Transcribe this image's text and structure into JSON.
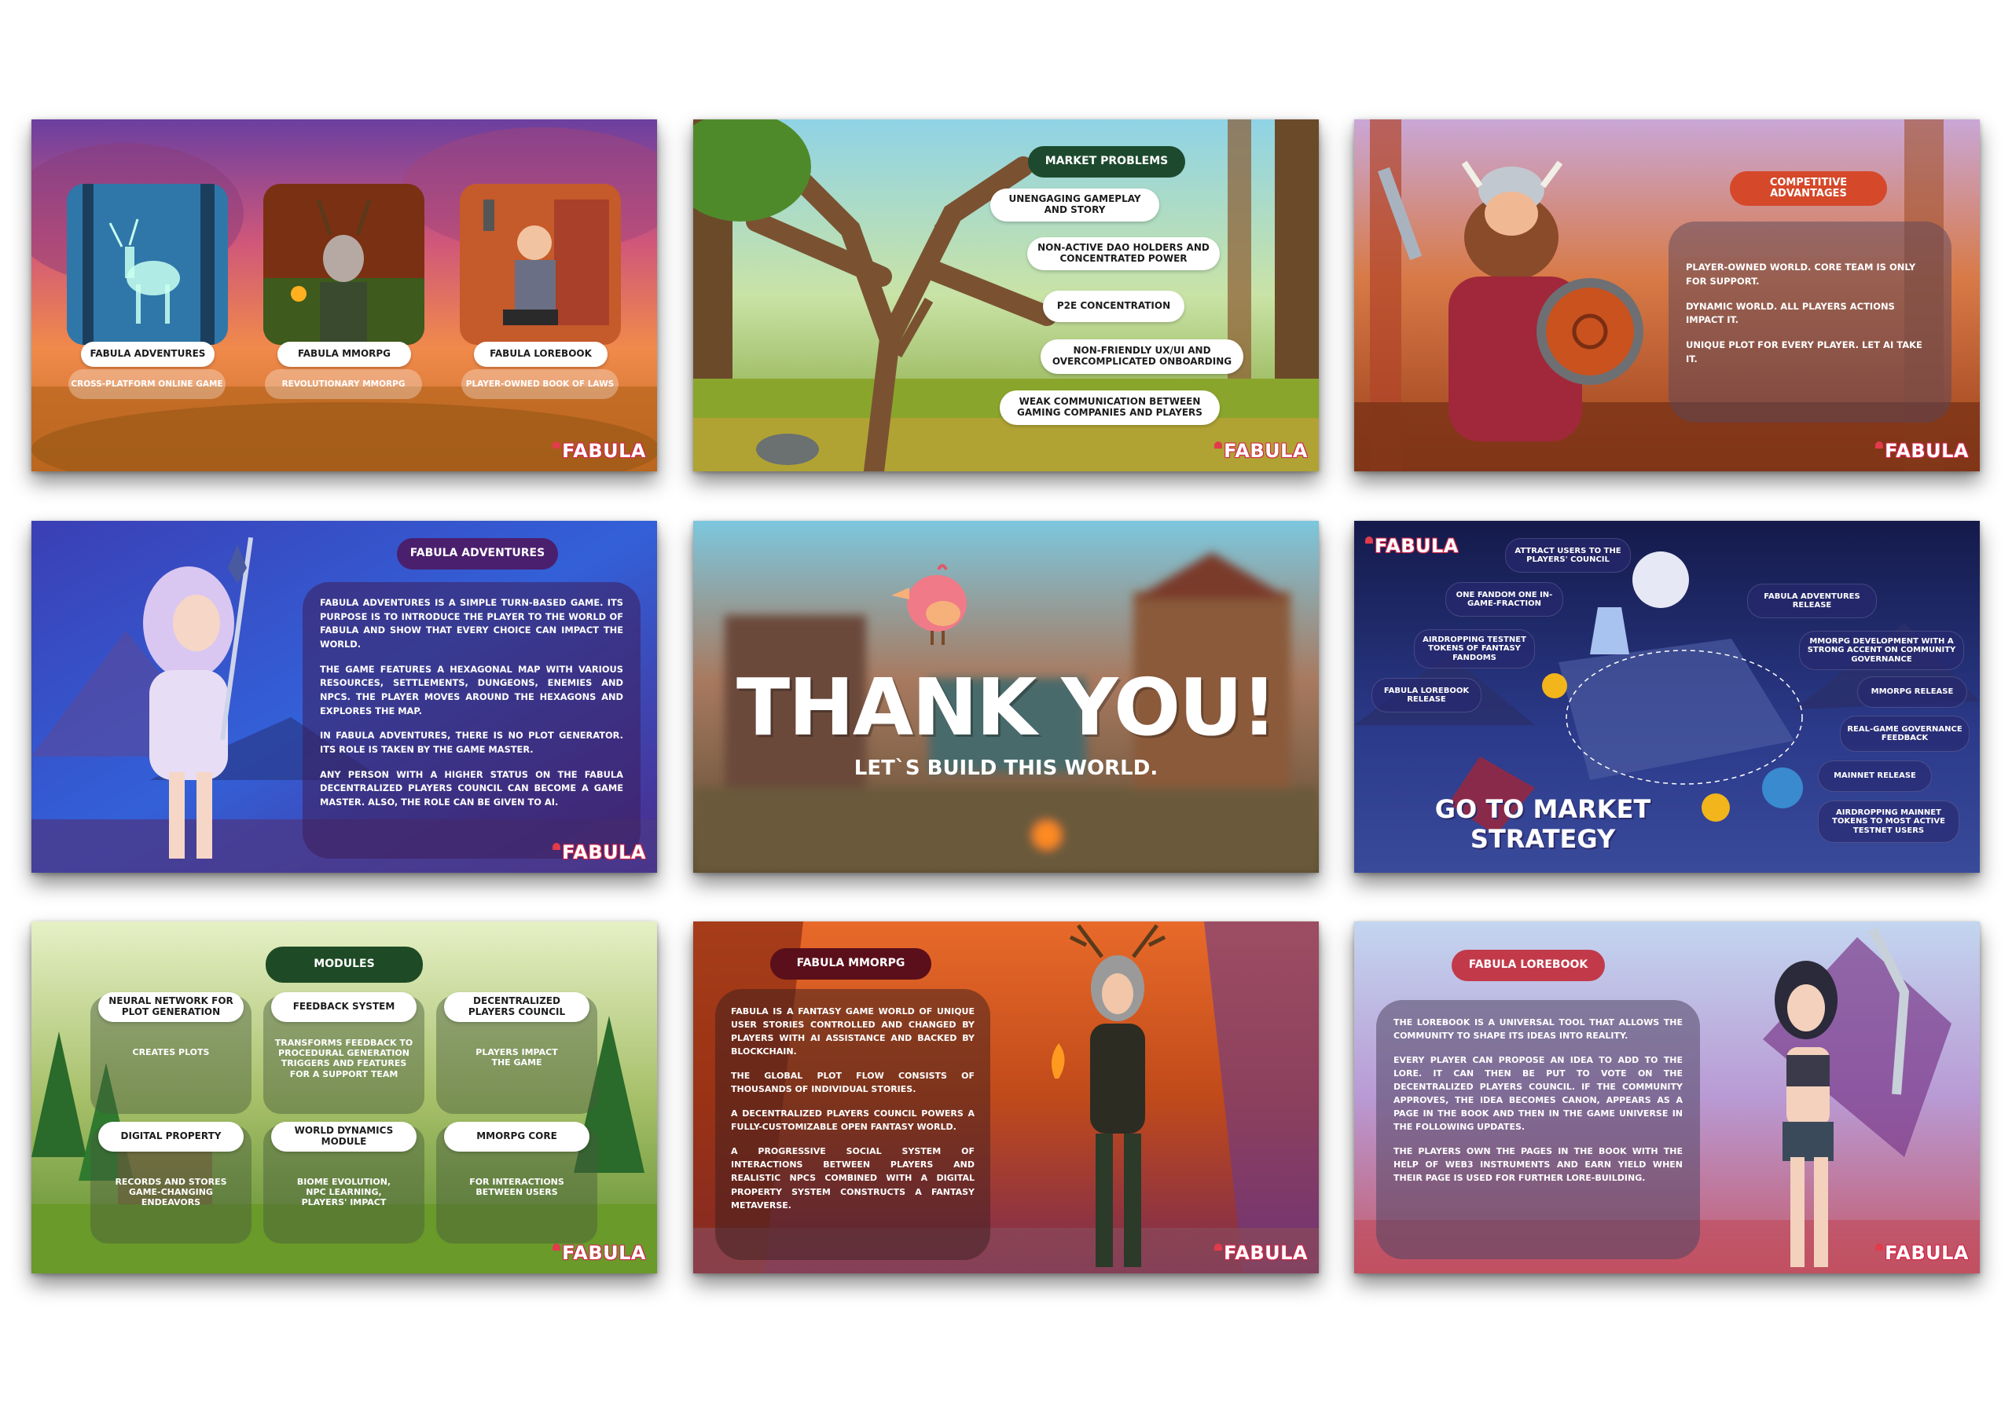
{
  "brand": {
    "logo": "FABULA"
  },
  "slide1": {
    "cards": [
      {
        "title": "FABULA ADVENTURES",
        "subtitle": "CROSS-PLATFORM ONLINE GAME"
      },
      {
        "title": "FABULA MMORPG",
        "subtitle": "REVOLUTIONARY MMORPG"
      },
      {
        "title": "FABULA LOREBOOK",
        "subtitle": "PLAYER-OWNED BOOK OF LAWS"
      }
    ]
  },
  "slide2": {
    "title": "MARKET PROBLEMS",
    "items": [
      "UNENGAGING GAMEPLAY AND STORY",
      "NON-ACTIVE DAO HOLDERS AND CONCENTRATED POWER",
      "P2E CONCENTRATION",
      "NON-FRIENDLY UX/UI AND OVERCOMPLICATED ONBOARDING",
      "WEAK COMMUNICATION BETWEEN GAMING COMPANIES AND PLAYERS"
    ]
  },
  "slide3": {
    "title": "COMPETITIVE ADVANTAGES",
    "paragraphs": [
      "PLAYER-OWNED WORLD. CORE TEAM IS ONLY FOR SUPPORT.",
      "DYNAMIC WORLD. ALL PLAYERS ACTIONS IMPACT IT.",
      "UNIQUE PLOT FOR EVERY PLAYER. LET AI TAKE IT."
    ]
  },
  "slide4": {
    "title": "FABULA ADVENTURES",
    "paragraphs": [
      "FABULA ADVENTURES IS A SIMPLE TURN-BASED GAME. ITS PURPOSE IS TO INTRODUCE THE PLAYER TO THE WORLD OF FABULA AND SHOW THAT EVERY CHOICE CAN IMPACT THE WORLD.",
      "THE GAME FEATURES A HEXAGONAL MAP WITH VARIOUS RESOURCES, SETTLEMENTS, DUNGEONS, ENEMIES AND NPCS. THE PLAYER MOVES AROUND THE HEXAGONS AND EXPLORES THE MAP.",
      "IN FABULA ADVENTURES, THERE IS NO PLOT GENERATOR. ITS ROLE IS TAKEN BY THE GAME MASTER.",
      "ANY PERSON WITH A HIGHER STATUS ON THE FABULA DECENTRALIZED PLAYERS COUNCIL CAN BECOME A GAME MASTER. ALSO, THE ROLE CAN BE GIVEN TO AI."
    ]
  },
  "slide5": {
    "title": "THANK YOU!",
    "subtitle": "LET`S BUILD THIS WORLD."
  },
  "slide6": {
    "title_line1": "GO TO MARKET",
    "title_line2": "STRATEGY",
    "nodes": [
      "ATTRACT USERS TO THE PLAYERS' COUNCIL",
      "ONE FANDOM ONE IN-GAME-FRACTION",
      "AIRDROPPING TESTNET TOKENS OF FANTASY FANDOMS",
      "FABULA LOREBOOK RELEASE",
      "FABULA ADVENTURES RELEASE",
      "MMORPG DEVELOPMENT WITH A STRONG ACCENT ON COMMUNITY GOVERNANCE",
      "MMORPG RELEASE",
      "REAL-GAME GOVERNANCE FEEDBACK",
      "MAINNET RELEASE",
      "AIRDROPPING MAINNET TOKENS TO MOST ACTIVE TESTNET USERS"
    ]
  },
  "slide7": {
    "title": "MODULES",
    "modules": [
      {
        "name": "NEURAL NETWORK FOR PLOT GENERATION",
        "desc": "CREATES PLOTS"
      },
      {
        "name": "FEEDBACK SYSTEM",
        "desc": "TRANSFORMS FEEDBACK TO PROCEDURAL GENERATION TRIGGERS AND FEATURES FOR A SUPPORT TEAM"
      },
      {
        "name": "DECENTRALIZED PLAYERS COUNCIL",
        "desc": "PLAYERS IMPACT THE GAME"
      },
      {
        "name": "DIGITAL PROPERTY",
        "desc": "RECORDS AND STORES GAME-CHANGING ENDEAVORS"
      },
      {
        "name": "WORLD DYNAMICS MODULE",
        "desc": "BIOME EVOLUTION, NPC LEARNING, PLAYERS' IMPACT"
      },
      {
        "name": "MMORPG CORE",
        "desc": "FOR INTERACTIONS BETWEEN USERS"
      }
    ]
  },
  "slide8": {
    "title": "FABULA MMORPG",
    "paragraphs": [
      "FABULA IS A FANTASY GAME WORLD OF UNIQUE USER STORIES CONTROLLED AND CHANGED BY PLAYERS WITH AI ASSISTANCE AND BACKED BY BLOCKCHAIN.",
      "THE GLOBAL PLOT FLOW CONSISTS OF THOUSANDS OF INDIVIDUAL STORIES.",
      "A DECENTRALIZED PLAYERS COUNCIL POWERS A FULLY-CUSTOMIZABLE OPEN FANTASY WORLD.",
      "A PROGRESSIVE SOCIAL SYSTEM OF INTERACTIONS BETWEEN PLAYERS AND REALISTIC NPCS COMBINED WITH A DIGITAL PROPERTY SYSTEM CONSTRUCTS A FANTASY METAVERSE."
    ]
  },
  "slide9": {
    "title": "FABULA LOREBOOK",
    "paragraphs": [
      "THE LOREBOOK IS A UNIVERSAL TOOL THAT ALLOWS THE COMMUNITY TO SHAPE ITS IDEAS INTO REALITY.",
      "EVERY PLAYER CAN PROPOSE AN IDEA TO ADD TO THE LORE. IT CAN THEN BE PUT TO VOTE ON THE DECENTRALIZED PLAYERS COUNCIL. IF THE COMMUNITY APPROVES, THE IDEA BECOMES CANON, APPEARS AS A PAGE IN THE BOOK AND THEN IN THE GAME UNIVERSE IN THE FOLLOWING UPDATES.",
      "THE PLAYERS OWN THE PAGES IN THE BOOK WITH THE HELP OF WEB3 INSTRUMENTS AND EARN YIELD WHEN THEIR PAGE IS USED FOR FURTHER LORE-BUILDING."
    ]
  }
}
